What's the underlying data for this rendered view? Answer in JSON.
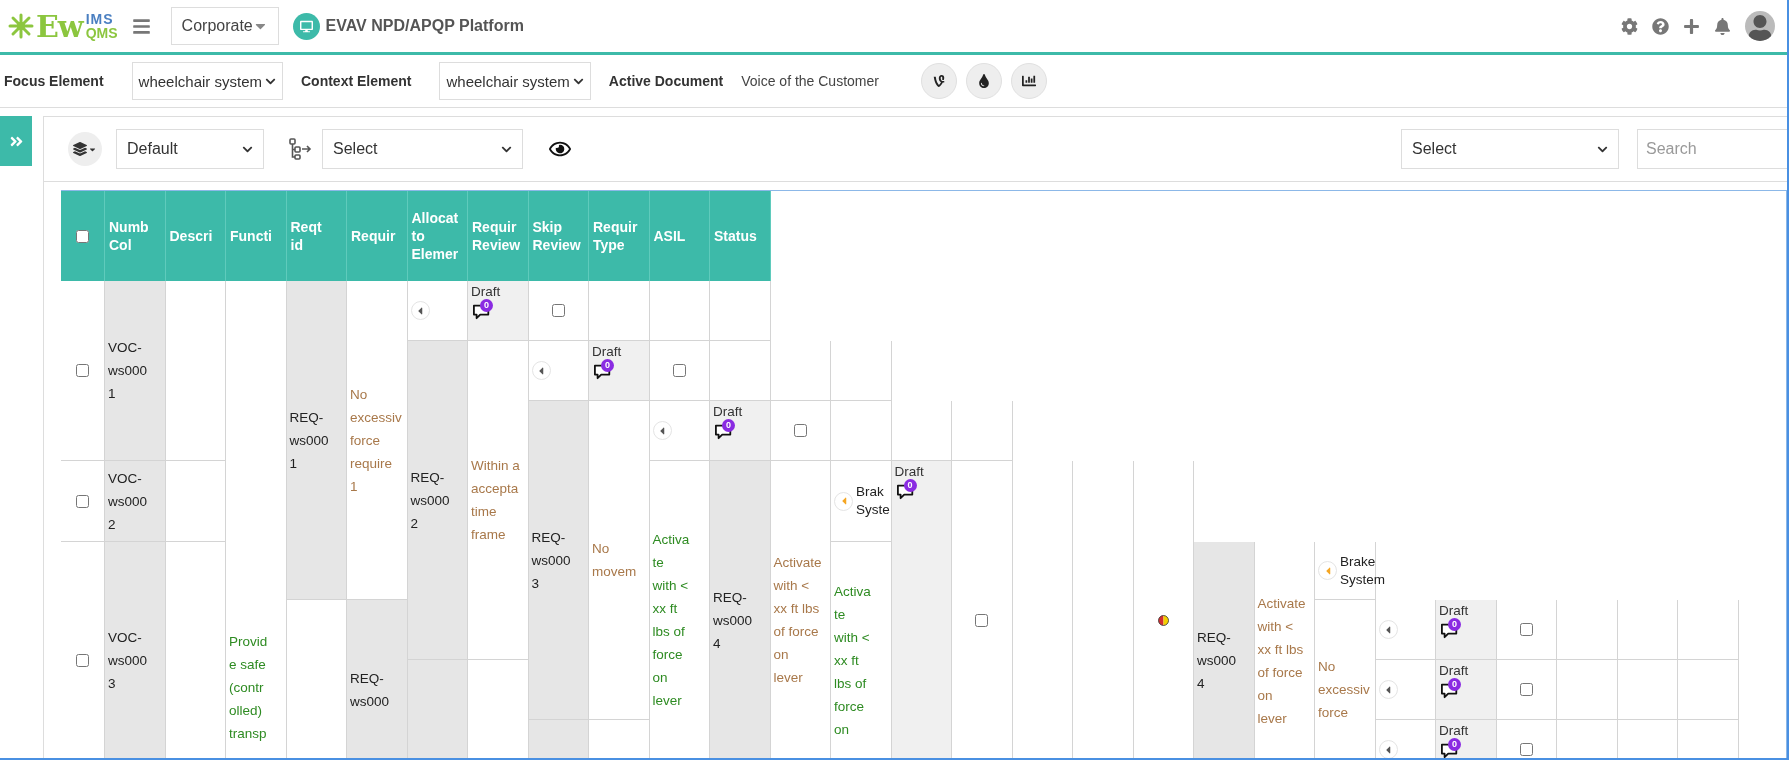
{
  "header": {
    "logo": {
      "main": "Ew",
      "sup": "IMS",
      "sub": "QMS"
    },
    "org_select": {
      "value": "Corporate"
    },
    "platform": "EVAV NPD/APQP Platform"
  },
  "context_bar": {
    "focus_label": "Focus Element",
    "focus_value": "wheelchair system",
    "context_label": "Context Element",
    "context_value": "wheelchair system",
    "document_label": "Active Document",
    "document_value": "Voice of the Customer"
  },
  "toolbar": {
    "view_select": "Default",
    "hierarchy_select": "Select",
    "filter_select": "Select",
    "search": {
      "placeholder": "Search"
    }
  },
  "table": {
    "columns": [
      {
        "kind": "checkbox",
        "checked": false
      },
      {
        "kind": "label",
        "label": "Numb\nCol"
      },
      {
        "kind": "label",
        "label": "Descri"
      },
      {
        "kind": "label",
        "label": "Functi"
      },
      {
        "kind": "label",
        "label": "Reqt\nid"
      },
      {
        "kind": "label",
        "label": "Requir"
      },
      {
        "kind": "label",
        "label": "Allocat\nto\nElemer"
      },
      {
        "kind": "label",
        "label": "Requir\nReview"
      },
      {
        "kind": "label",
        "label": "Skip\nReview"
      },
      {
        "kind": "label",
        "label": "Requir\nType"
      },
      {
        "kind": "label",
        "label": "ASIL"
      },
      {
        "kind": "label",
        "label": "Status"
      }
    ],
    "cells": [
      {
        "kind": "checkbox",
        "checked": false
      },
      {
        "kind": "id",
        "text": "VOC-\nws000\n1"
      },
      {
        "kind": "empty"
      },
      {
        "kind": "checkbox",
        "checked": false
      },
      {
        "kind": "id",
        "text": "VOC-\nws000\n2"
      },
      {
        "kind": "empty"
      },
      {
        "kind": "checkbox",
        "checked": false
      },
      {
        "kind": "id",
        "text": "VOC-\nws000\n3"
      },
      {
        "kind": "empty"
      },
      {
        "kind": "text",
        "text": "Provid\ne safe\n(contr\nolled)\ntransp",
        "color": "#2e8b22"
      },
      {
        "kind": "id",
        "text": "REQ-\nws000\n1"
      },
      {
        "kind": "empty"
      },
      {
        "kind": "text",
        "text": "No\nexcessiv\nforce\nrequire\n1",
        "color": "#a8784a"
      },
      {
        "kind": "id",
        "text": "REQ-\nws000"
      },
      {
        "kind": "expand"
      },
      {
        "kind": "id",
        "text": "REQ-\nws000\n2"
      },
      {
        "kind": "shaded"
      },
      {
        "kind": "draft",
        "text": "Draft",
        "comments": "0"
      },
      {
        "kind": "text",
        "text": "Within a\naccepta\ntime\nframe",
        "color": "#a8784a"
      },
      {
        "kind": "empty"
      },
      {
        "kind": "checkbox",
        "checked": false
      },
      {
        "kind": "expand"
      },
      {
        "kind": "id",
        "text": "REQ-\nws000\n3"
      },
      {
        "kind": "shaded"
      },
      {
        "kind": "empty"
      },
      {
        "kind": "draft",
        "text": "Draft",
        "comments": "0"
      },
      {
        "kind": "text",
        "text": "No\nmovem",
        "color": "#a8784a"
      },
      {
        "kind": "empty"
      },
      {
        "kind": "empty"
      },
      {
        "kind": "checkbox",
        "checked": false
      },
      {
        "kind": "expand"
      },
      {
        "kind": "text",
        "text": "Activa\nte\nwith <\nxx ft\nlbs of\nforce\non\nlever",
        "color": "#2e8b22"
      },
      {
        "kind": "empty"
      },
      {
        "kind": "empty"
      },
      {
        "kind": "draft",
        "text": "Draft",
        "comments": "0"
      },
      {
        "kind": "id",
        "text": "REQ-\nws000\n4"
      },
      {
        "kind": "empty"
      },
      {
        "kind": "checkbox",
        "checked": false
      },
      {
        "kind": "text",
        "text": "Activate\nwith <\nxx ft lbs\nof force\non\nlever",
        "color": "#a8784a"
      },
      {
        "kind": "empty"
      },
      {
        "kind": "empty"
      },
      {
        "kind": "element",
        "text": "Brak\nSyste"
      },
      {
        "kind": "text",
        "text": "Activa\nte\nwith <\nxx ft\nlbs of\nforce\non",
        "color": "#2e8b22"
      },
      {
        "kind": "empty"
      },
      {
        "kind": "draft",
        "text": "Draft",
        "comments": "0"
      },
      {
        "kind": "empty"
      },
      {
        "kind": "checkbox",
        "checked": false
      },
      {
        "kind": "empty"
      },
      {
        "kind": "empty"
      },
      {
        "kind": "status"
      },
      {
        "kind": "id",
        "text": "REQ-\nws000\n4"
      },
      {
        "kind": "text",
        "text": "Activate\nwith <\nxx ft lbs\nof force\non\nlever",
        "color": "#a8784a"
      },
      {
        "kind": "element",
        "text": "Brake\nSystem"
      },
      {
        "kind": "text",
        "text": "No\nexcessiv\nforce",
        "color": "#a8784a"
      },
      {
        "kind": "expand"
      },
      {
        "kind": "expand"
      },
      {
        "kind": "expand"
      },
      {
        "kind": "draft",
        "text": "Draft",
        "comments": "0"
      },
      {
        "kind": "draft",
        "text": "Draft",
        "comments": "0"
      },
      {
        "kind": "draft",
        "text": "Draft",
        "comments": "0"
      },
      {
        "kind": "checkbox",
        "checked": false
      },
      {
        "kind": "checkbox",
        "checked": false
      },
      {
        "kind": "checkbox",
        "checked": false
      },
      {
        "kind": "empty"
      },
      {
        "kind": "empty"
      },
      {
        "kind": "empty"
      },
      {
        "kind": "empty"
      },
      {
        "kind": "empty"
      },
      {
        "kind": "empty"
      },
      {
        "kind": "empty"
      },
      {
        "kind": "empty"
      },
      {
        "kind": "empty"
      }
    ]
  }
}
